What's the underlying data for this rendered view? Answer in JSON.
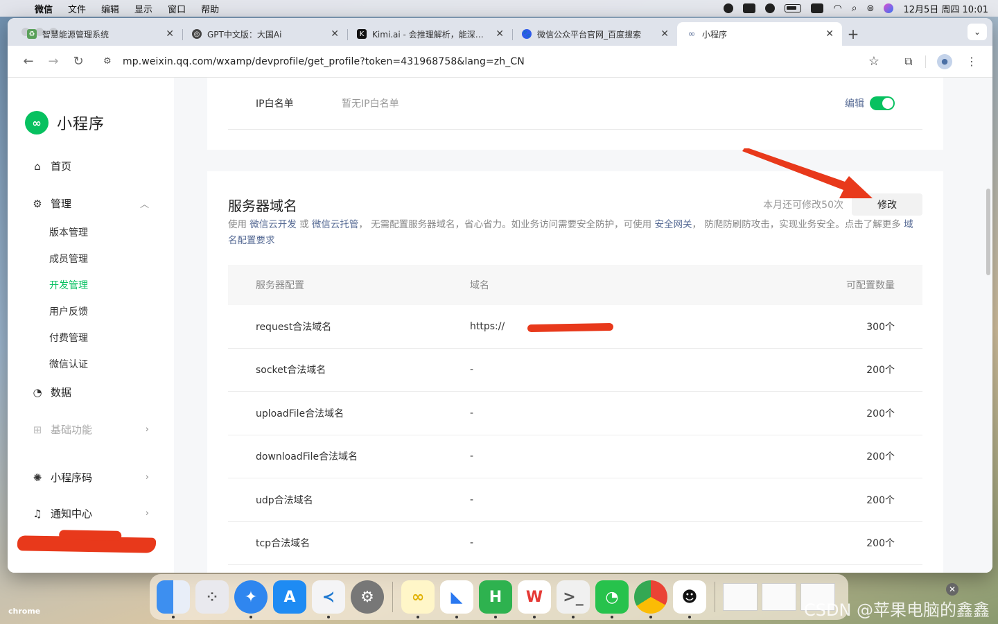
{
  "menubar": {
    "app": "微信",
    "items": [
      "文件",
      "编辑",
      "显示",
      "窗口",
      "帮助"
    ],
    "clock": "12月5日 周四 10:01"
  },
  "tabs": [
    {
      "title": "智慧能源管理系统",
      "favicon_color": "#5aa05a"
    },
    {
      "title": "GPT中文版：大国Ai",
      "favicon_color": "#444444"
    },
    {
      "title": "Kimi.ai - 会推理解析，能深度思",
      "favicon_color": "#111111"
    },
    {
      "title": "微信公众平台官网_百度搜索",
      "favicon_color": "#2f5bea"
    },
    {
      "title": "小程序",
      "favicon_color": "#576b95"
    }
  ],
  "address_bar": {
    "url": "mp.weixin.qq.com/wxamp/devprofile/get_profile?token=431968758&lang=zh_CN"
  },
  "sidebar": {
    "brand": "小程序",
    "nav": {
      "home": "首页",
      "manage": "管理",
      "sub": [
        "版本管理",
        "成员管理",
        "开发管理",
        "用户反馈",
        "付费管理",
        "微信认证"
      ],
      "data": "数据",
      "basic": "基础功能",
      "qrcode": "小程序码",
      "notice": "通知中心"
    }
  },
  "ip_whitelist": {
    "label": "IP白名单",
    "value": "暂无IP白名单",
    "edit": "编辑",
    "enabled": true
  },
  "server_domain": {
    "title": "服务器域名",
    "quota_text": "本月还可修改50次",
    "modify_button": "修改",
    "desc_parts": {
      "p1": "使用 ",
      "link1": "微信云开发",
      "p2": " 或 ",
      "link2": "微信云托管",
      "p3": "， 无需配置服务器域名，省心省力。如业务访问需要安全防护，可使用 ",
      "link3": "安全网关",
      "p4": "， 防爬防刷防攻击，实现业务安全。点击了解更多 ",
      "link4": "域名配置要求"
    },
    "columns": [
      "服务器配置",
      "域名",
      "可配置数量"
    ],
    "rows": [
      {
        "config": "request合法域名",
        "domain": "https://",
        "count": "300个"
      },
      {
        "config": "socket合法域名",
        "domain": "-",
        "count": "200个"
      },
      {
        "config": "uploadFile合法域名",
        "domain": "-",
        "count": "200个"
      },
      {
        "config": "downloadFile合法域名",
        "domain": "-",
        "count": "200个"
      },
      {
        "config": "udp合法域名",
        "domain": "-",
        "count": "200个"
      },
      {
        "config": "tcp合法域名",
        "domain": "-",
        "count": "200个"
      }
    ]
  },
  "desktop": {
    "dock_label": "chrome",
    "watermark": "CSDN @苹果电脑的鑫鑫"
  },
  "colors": {
    "brand_green": "#07c160",
    "link_blue": "#576b95",
    "annotation_red": "#e8391b"
  }
}
